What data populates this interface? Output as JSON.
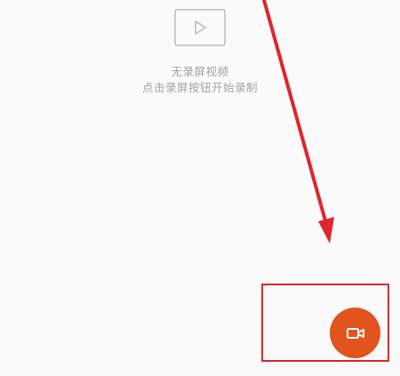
{
  "empty_state": {
    "icon": "video-play-icon",
    "title": "无录屏视频",
    "hint": "点击录屏按钮开始录制"
  },
  "record_button": {
    "icon": "video-camera-icon",
    "color": "#e2541e"
  },
  "annotation": {
    "color": "#e0262a"
  }
}
